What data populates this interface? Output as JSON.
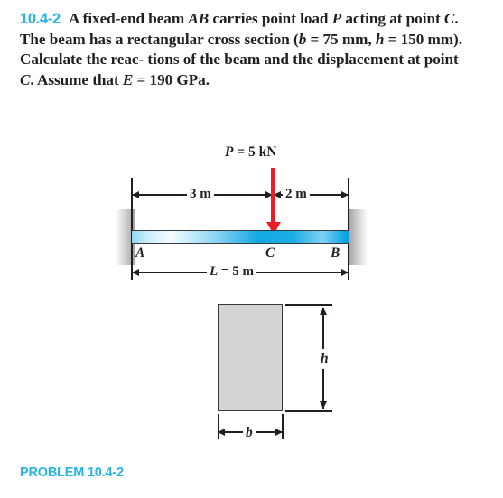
{
  "problem": {
    "number": "10.4-2",
    "sentences": {
      "s1_a": "A fixed-end beam ",
      "s1_ab": "AB",
      "s1_b": " carries point load ",
      "s1_p": "P",
      "s2_a": "acting at point ",
      "s2_c": "C",
      "s2_b": ". The beam has a rectangular cross",
      "s3_a": "section (",
      "s3_b": "b",
      "s3_c": " = 75 mm, ",
      "s3_d": "h",
      "s3_e": " = 150 mm). Calculate the reac-",
      "s4": "tions of the beam and the displacement at point ",
      "s4_c": "C",
      "s4_end": ".",
      "s5_a": "Assume that ",
      "s5_e": "E",
      "s5_b": " = 190 GPa."
    }
  },
  "figure": {
    "load": {
      "label_var": "P",
      "label_value": " = 5 kN",
      "magnitude": 5,
      "unit": "kN"
    },
    "dimensions": {
      "left_span": "3 m",
      "right_span": "2 m",
      "total_var": "L",
      "total_value": " = 5 m",
      "total_length": 5,
      "unit": "m"
    },
    "points": {
      "a": "A",
      "c": "C",
      "b": "B"
    },
    "cross_section": {
      "height_label": "h",
      "width_label": "b",
      "height_mm": 150,
      "width_mm": 75
    },
    "colors": {
      "beam": "#15a9e4",
      "load_arrow": "#ee1c25",
      "section_fill": "#d4d4d4",
      "accent": "#29b4e8"
    }
  },
  "caption": {
    "text": "PROBLEM 10.4-2"
  }
}
